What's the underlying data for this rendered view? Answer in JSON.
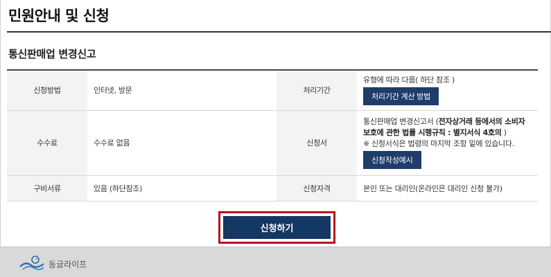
{
  "page": {
    "title": "민원안내 및 신청",
    "section_title": "통신판매업 변경신고"
  },
  "table": {
    "method_label": "신청방법",
    "method_value": "인터넷, 방문",
    "period_label": "처리기간",
    "period_value": "유형에 따라 다름( 하단 참조 )",
    "period_button": "처리기간 계산 방법",
    "fee_label": "수수료",
    "fee_value": "수수료 없음",
    "form_label": "신청서",
    "form_value_prefix": "통신판매업 변경신고서 (",
    "form_value_bold_1": "전자상거래 등에서의 소비자",
    "form_value_bold_2": "보호에 관한 법률 시행규칙 : 별지서식 4호의",
    "form_value_suffix": " )",
    "form_note": "※ 신청서식은 법령의 마지막 조항 밑에 있습니다.",
    "form_button": "신청작성예시",
    "docs_label": "구비서류",
    "docs_value": "있음 (하단참조)",
    "qual_label": "신청자격",
    "qual_value": "본인 또는 대리인(온라인은 대리인 신청 불가)"
  },
  "apply_button": "신청하기",
  "footer": {
    "logo_text": "동글라이프",
    "logo_icon": "bird-wave-logo-icon"
  }
}
